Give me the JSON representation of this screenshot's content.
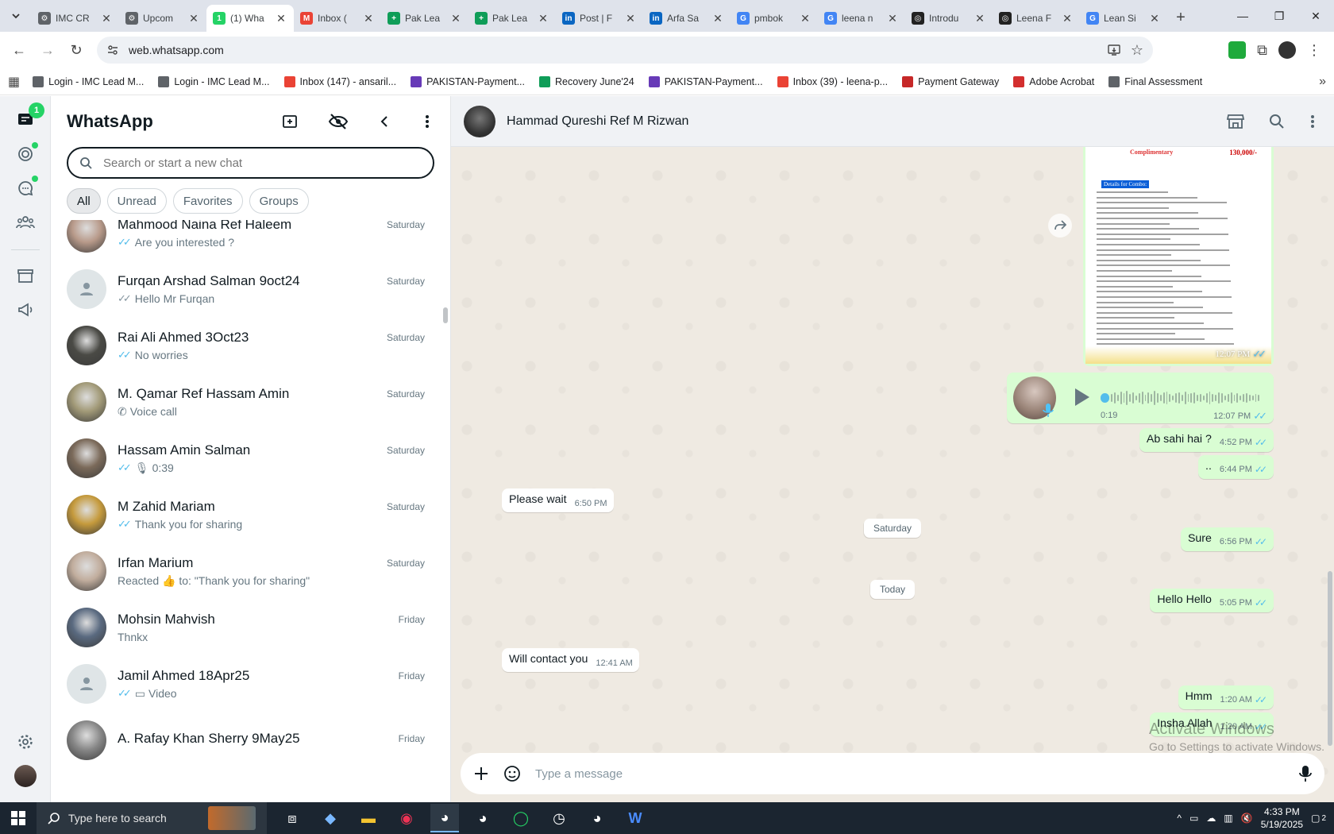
{
  "browser": {
    "tabs": [
      {
        "label": "IMC CR",
        "color": "#5f6368",
        "letter": "⚙"
      },
      {
        "label": "Upcom",
        "color": "#5f6368",
        "letter": "⚙"
      },
      {
        "label": "(1) Wha",
        "color": "#25d366",
        "letter": "1",
        "active": true
      },
      {
        "label": "Inbox (",
        "color": "#ea4335",
        "letter": "M"
      },
      {
        "label": "Pak Lea",
        "color": "#0f9d58",
        "letter": "+"
      },
      {
        "label": "Pak Lea",
        "color": "#0f9d58",
        "letter": "+"
      },
      {
        "label": "Post | F",
        "color": "#0a66c2",
        "letter": "in"
      },
      {
        "label": "Arfa Sa",
        "color": "#0a66c2",
        "letter": "in"
      },
      {
        "label": "pmbok",
        "color": "#4285f4",
        "letter": "G"
      },
      {
        "label": "leena n",
        "color": "#4285f4",
        "letter": "G"
      },
      {
        "label": "Introdu",
        "color": "#222222",
        "letter": "◎"
      },
      {
        "label": "Leena F",
        "color": "#222222",
        "letter": "◎"
      },
      {
        "label": "Lean Si",
        "color": "#4285f4",
        "letter": "G"
      }
    ],
    "url": "web.whatsapp.com",
    "bookmarks": [
      {
        "label": "Login - IMC Lead M...",
        "color": "#5f6368"
      },
      {
        "label": "Login - IMC Lead M...",
        "color": "#5f6368"
      },
      {
        "label": "Inbox (147) - ansaril...",
        "color": "#ea4335"
      },
      {
        "label": "PAKISTAN-Payment...",
        "color": "#673ab7"
      },
      {
        "label": "Recovery June'24",
        "color": "#0f9d58"
      },
      {
        "label": "PAKISTAN-Payment...",
        "color": "#673ab7"
      },
      {
        "label": "Inbox (39) - leena-p...",
        "color": "#ea4335"
      },
      {
        "label": "Payment Gateway",
        "color": "#c62828"
      },
      {
        "label": "Adobe Acrobat",
        "color": "#d32f2f"
      },
      {
        "label": "Final Assessment",
        "color": "#5f6368"
      }
    ]
  },
  "rail": {
    "chats_badge": "1"
  },
  "sidebar": {
    "title": "WhatsApp",
    "search_placeholder": "Search or start a new chat",
    "filters": [
      "All",
      "Unread",
      "Favorites",
      "Groups"
    ],
    "chats": [
      {
        "name": "Mahmood Naina Ref Haleem",
        "time": "Saturday",
        "preview": "Are you interested ?",
        "ticks": "read",
        "avatar": "#b89a8a"
      },
      {
        "name": "Furqan Arshad Salman 9oct24",
        "time": "Saturday",
        "preview": "Hello Mr Furqan",
        "ticks": "delivered",
        "avatar": "generic"
      },
      {
        "name": "Rai Ali Ahmed 3Oct23",
        "time": "Saturday",
        "preview": "No worries",
        "ticks": "read",
        "avatar": "#4a4a45"
      },
      {
        "name": "M. Qamar Ref Hassam Amin",
        "time": "Saturday",
        "preview": "Voice call",
        "ticks": "call",
        "avatar": "#a29a78"
      },
      {
        "name": "Hassam Amin Salman",
        "time": "Saturday",
        "preview": "0:39",
        "ticks": "voice",
        "avatar": "#7b6a5a"
      },
      {
        "name": "M Zahid Mariam",
        "time": "Saturday",
        "preview": "Thank you for sharing",
        "ticks": "read",
        "avatar": "#c59a3c"
      },
      {
        "name": "Irfan Marium",
        "time": "Saturday",
        "preview": "Reacted 👍 to: \"Thank you for sharing\"",
        "ticks": "none",
        "avatar": "#c1ad9d"
      },
      {
        "name": "Mohsin Mahvish",
        "time": "Friday",
        "preview": "Thnkx",
        "ticks": "none",
        "avatar": "#5a6a80"
      },
      {
        "name": "Jamil Ahmed 18Apr25",
        "time": "Friday",
        "preview": "Video",
        "ticks": "video",
        "avatar": "generic"
      },
      {
        "name": "A. Rafay Khan Sherry 9May25",
        "time": "Friday",
        "preview": "",
        "ticks": "none",
        "avatar": "#888888"
      }
    ]
  },
  "conversation": {
    "contact_name": "Hammad Qureshi Ref M Rizwan",
    "image_message": {
      "time": "12:07 PM",
      "doc_title": "Complimentary",
      "doc_price": "130,000/-",
      "doc_section": "Details for Combo:"
    },
    "voice_message": {
      "duration": "0:19",
      "time": "12:07 PM"
    },
    "messages": [
      {
        "dir": "out",
        "text": "Ab sahi hai ?",
        "time": "4:52 PM"
      },
      {
        "dir": "out",
        "text": "..",
        "time": "6:44 PM"
      },
      {
        "dir": "in",
        "text": "Please wait",
        "time": "6:50 PM"
      },
      {
        "dir": "out",
        "text": "Sure",
        "time": "6:56 PM"
      },
      {
        "dir": "out",
        "text": "Hello Hello",
        "time": "5:05 PM"
      },
      {
        "dir": "in",
        "text": "Will contact you",
        "time": "12:41 AM"
      },
      {
        "dir": "out",
        "text": "Hmm",
        "time": "1:20 AM"
      },
      {
        "dir": "out",
        "text": "Insha Allah",
        "time": "1:20 AM"
      }
    ],
    "day_separators": [
      "Saturday",
      "Today"
    ],
    "compose_placeholder": "Type a message",
    "watermark_title": "Activate Windows",
    "watermark_sub": "Go to Settings to activate Windows."
  },
  "taskbar": {
    "search_placeholder": "Type here to search",
    "time": "4:33 PM",
    "date": "5/19/2025",
    "notifications": "2"
  },
  "colors": {
    "accent": "#25d366",
    "outgoing_bubble": "#d9fdd3",
    "read_ticks": "#53bdeb"
  }
}
